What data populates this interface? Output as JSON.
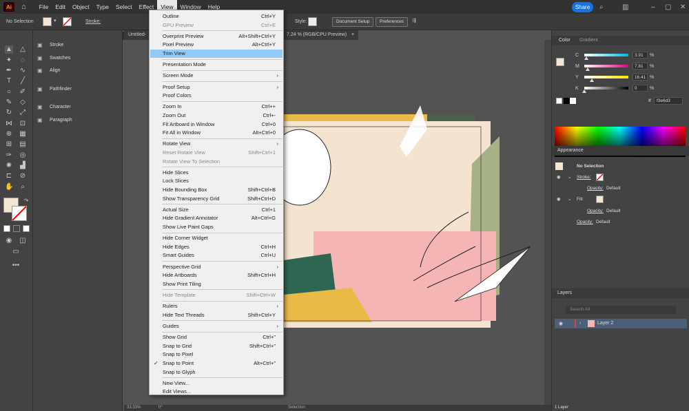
{
  "menubar": {
    "items": [
      "File",
      "Edit",
      "Object",
      "Type",
      "Select",
      "Effect",
      "View",
      "Window",
      "Help"
    ],
    "active": "View",
    "share": "Share",
    "logo": "Ai"
  },
  "controlbar": {
    "selection": "No Selection",
    "stroke_label": "Stroke:",
    "style_label": "Style:",
    "doc_setup": "Document Setup",
    "preferences": "Preferences"
  },
  "doctab": {
    "title_left": "Untitled-",
    "title_right": "7.24 % (RGB/CPU Preview)",
    "close": "×"
  },
  "left_panels": [
    {
      "icon": "stroke-icon",
      "label": "Stroke"
    },
    {
      "icon": "swatches-icon",
      "label": "Swatches"
    },
    {
      "icon": "align-icon",
      "label": "Align"
    },
    {
      "icon": "pathfinder-icon",
      "label": "Pathfinder"
    },
    {
      "icon": "character-icon",
      "label": "Character"
    },
    {
      "icon": "paragraph-icon",
      "label": "Paragraph"
    }
  ],
  "view_menu": [
    {
      "label": "Outline",
      "shortcut": "Ctrl+Y"
    },
    {
      "label": "GPU Preview",
      "shortcut": "Ctrl+E",
      "disabled": true
    },
    {
      "sep": true
    },
    {
      "label": "Overprint Preview",
      "shortcut": "Alt+Shift+Ctrl+Y"
    },
    {
      "label": "Pixel Preview",
      "shortcut": "Alt+Ctrl+Y"
    },
    {
      "label": "Trim View",
      "shortcut": "",
      "highlight": true
    },
    {
      "sep": true
    },
    {
      "label": "Presentation Mode",
      "shortcut": ""
    },
    {
      "sep": true
    },
    {
      "label": "Screen Mode",
      "shortcut": "",
      "submenu": true
    },
    {
      "sep": true
    },
    {
      "label": "Proof Setup",
      "shortcut": "",
      "submenu": true
    },
    {
      "label": "Proof Colors",
      "shortcut": ""
    },
    {
      "sep": true
    },
    {
      "label": "Zoom In",
      "shortcut": "Ctrl++"
    },
    {
      "label": "Zoom Out",
      "shortcut": "Ctrl+-"
    },
    {
      "label": "Fit Artboard in Window",
      "shortcut": "Ctrl+0"
    },
    {
      "label": "Fit All in Window",
      "shortcut": "Alt+Ctrl+0"
    },
    {
      "sep": true
    },
    {
      "label": "Rotate View",
      "shortcut": "",
      "submenu": true
    },
    {
      "label": "Reset Rotate View",
      "shortcut": "Shift+Ctrl+1",
      "disabled": true
    },
    {
      "label": "Rotate View To Selection",
      "shortcut": "",
      "disabled": true
    },
    {
      "sep": true
    },
    {
      "label": "Hide Slices",
      "shortcut": ""
    },
    {
      "label": "Lock Slices",
      "shortcut": ""
    },
    {
      "label": "Hide Bounding Box",
      "shortcut": "Shift+Ctrl+B"
    },
    {
      "label": "Show Transparency Grid",
      "shortcut": "Shift+Ctrl+D"
    },
    {
      "sep": true
    },
    {
      "label": "Actual Size",
      "shortcut": "Ctrl+1"
    },
    {
      "label": "Hide Gradient Annotator",
      "shortcut": "Alt+Ctrl+G"
    },
    {
      "label": "Show Live Paint Gaps",
      "shortcut": ""
    },
    {
      "sep": true
    },
    {
      "label": "Hide Corner Widget",
      "shortcut": ""
    },
    {
      "label": "Hide Edges",
      "shortcut": "Ctrl+H"
    },
    {
      "label": "Smart Guides",
      "shortcut": "Ctrl+U"
    },
    {
      "sep": true
    },
    {
      "label": "Perspective Grid",
      "shortcut": "",
      "submenu": true
    },
    {
      "label": "Hide Artboards",
      "shortcut": "Shift+Ctrl+H"
    },
    {
      "label": "Show Print Tiling",
      "shortcut": ""
    },
    {
      "sep": true
    },
    {
      "label": "Hide Template",
      "shortcut": "Shift+Ctrl+W",
      "disabled": true
    },
    {
      "sep": true
    },
    {
      "label": "Rulers",
      "shortcut": "",
      "submenu": true
    },
    {
      "label": "Hide Text Threads",
      "shortcut": "Shift+Ctrl+Y"
    },
    {
      "sep": true
    },
    {
      "label": "Guides",
      "shortcut": "",
      "submenu": true
    },
    {
      "sep": true
    },
    {
      "label": "Show Grid",
      "shortcut": "Ctrl+\""
    },
    {
      "label": "Snap to Grid",
      "shortcut": "Shift+Ctrl+\""
    },
    {
      "label": "Snap to Pixel",
      "shortcut": ""
    },
    {
      "label": "Snap to Point",
      "shortcut": "Alt+Ctrl+\"",
      "checked": true
    },
    {
      "label": "Snap to Glyph",
      "shortcut": ""
    },
    {
      "sep": true
    },
    {
      "label": "New View...",
      "shortcut": ""
    },
    {
      "label": "Edit Views...",
      "shortcut": ""
    }
  ],
  "color_panel": {
    "tabs": [
      "Color",
      "Gradient"
    ],
    "channels": [
      {
        "name": "C",
        "value": "3.91"
      },
      {
        "name": "M",
        "value": "7.81"
      },
      {
        "name": "Y",
        "value": "16.41"
      },
      {
        "name": "K",
        "value": "0"
      }
    ],
    "pct": "%",
    "hex": "f3e6d3",
    "fill_color": "#f3e6d3"
  },
  "appearance_panel": {
    "title": "Appearance",
    "selection": "No Selection",
    "stroke": "Stroke:",
    "fill": "Fill:",
    "opacity_label": "Opacity:",
    "opacity_value": "Default"
  },
  "layers_panel": {
    "title": "Layers",
    "search_placeholder": "Search All",
    "layer_name": "Layer 2",
    "footer": "1 Layer"
  },
  "status": {
    "zoom": "33.33%",
    "rotation": "0°",
    "mode": "Selection"
  }
}
